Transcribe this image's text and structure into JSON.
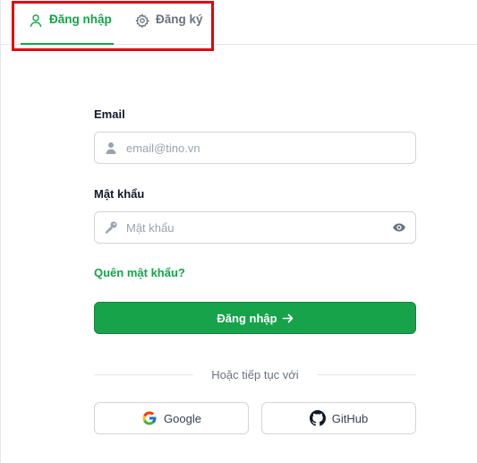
{
  "tabs": {
    "login_label": "Đăng nhập",
    "register_label": "Đăng ký"
  },
  "form": {
    "email_label": "Email",
    "email_placeholder": "email@tino.vn",
    "password_label": "Mật khẩu",
    "password_placeholder": "Mật khẩu",
    "forgot_label": "Quên mật khẩu?",
    "submit_label": "Đăng nhập"
  },
  "social": {
    "divider_text": "Hoặc tiếp tục với",
    "google_label": "Google",
    "github_label": "GitHub"
  },
  "colors": {
    "accent": "#16a34a",
    "highlight": "#e3000f"
  },
  "icons": [
    "user-icon",
    "gear-icon",
    "person-icon",
    "key-icon",
    "eye-icon",
    "arrow-right-icon",
    "google-icon",
    "github-icon"
  ]
}
